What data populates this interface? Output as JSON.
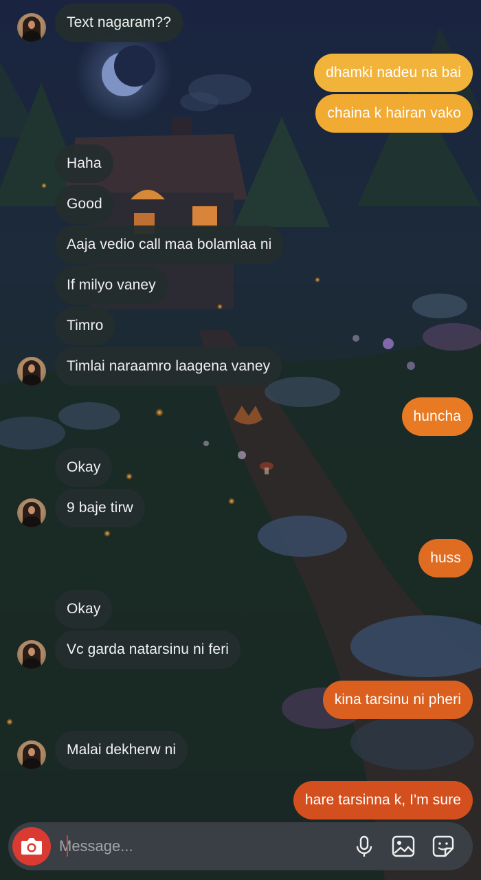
{
  "theme": {
    "incoming_bubble": "#242e2e",
    "outgoing_colors": [
      "#f2b33a",
      "#f1aa32",
      "#e77a22",
      "#e06c22",
      "#db5f1f",
      "#d44f1e"
    ],
    "composer_bg": "#3a3f45",
    "camera_button": "#d93a32"
  },
  "messages": [
    {
      "side": "in",
      "text": "Text nagaram??",
      "avatar": true
    },
    {
      "side": "out",
      "text": "dhamki nadeu na bai"
    },
    {
      "side": "out",
      "text": "chaina k hairan vako"
    },
    {
      "side": "in",
      "text": "Haha",
      "avatar": false
    },
    {
      "side": "in",
      "text": "Good",
      "avatar": false
    },
    {
      "side": "in",
      "text": "Aaja vedio call maa bolamlaa ni",
      "avatar": false
    },
    {
      "side": "in",
      "text": "If milyo vaney",
      "avatar": false
    },
    {
      "side": "in",
      "text": "Timro",
      "avatar": false
    },
    {
      "side": "in",
      "text": "Timlai naraamro laagena vaney",
      "avatar": true
    },
    {
      "side": "out",
      "text": "huncha"
    },
    {
      "side": "in",
      "text": "Okay",
      "avatar": false
    },
    {
      "side": "in",
      "text": "9 baje tirw",
      "avatar": true
    },
    {
      "side": "out",
      "text": "huss"
    },
    {
      "side": "in",
      "text": "Okay",
      "avatar": false
    },
    {
      "side": "in",
      "text": "Vc garda natarsinu ni feri",
      "avatar": true
    },
    {
      "side": "out",
      "text": "kina tarsinu ni pheri"
    },
    {
      "side": "in",
      "text": "Malai dekherw ni",
      "avatar": true
    },
    {
      "side": "out",
      "text": "hare tarsinna k, I'm sure"
    }
  ],
  "composer": {
    "placeholder": "Message...",
    "icons": [
      "camera-icon",
      "microphone-icon",
      "gallery-icon",
      "sticker-icon"
    ]
  }
}
